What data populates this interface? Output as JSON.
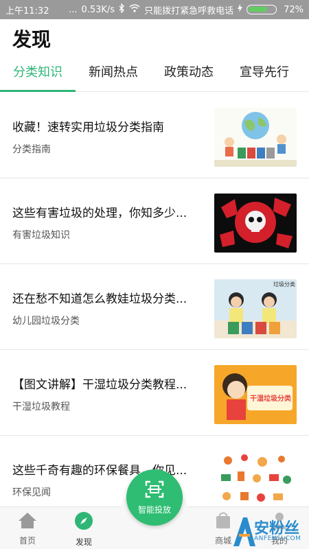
{
  "status_bar": {
    "time": "上午11:32",
    "dots": "...",
    "speed": "0.53K/s",
    "emergency_text": "只能拨打紧急呼救电话",
    "battery_level": 0.72,
    "battery_pct": "72%"
  },
  "header": {
    "title": "发现"
  },
  "tabs": [
    {
      "label": "分类知识",
      "active": true
    },
    {
      "label": "新闻热点",
      "active": false
    },
    {
      "label": "政策动态",
      "active": false
    },
    {
      "label": "宣导先行",
      "active": false
    }
  ],
  "articles": [
    {
      "title": "收藏！速转实用垃圾分类指南",
      "tag": "分类指南",
      "thumb_icon": "recycling-illustration-image"
    },
    {
      "title": "这些有害垃圾的处理，你知多少...",
      "tag": "有害垃圾知识",
      "thumb_icon": "skull-hazard-image"
    },
    {
      "title": "还在愁不知道怎么教娃垃圾分类...",
      "tag": "幼儿园垃圾分类",
      "thumb_icon": "children-sorting-photo",
      "thumb_text": "垃圾分类"
    },
    {
      "title": "【图文讲解】干湿垃圾分类教程...",
      "tag": "干湿垃圾教程",
      "thumb_icon": "dry-wet-sorting-illustration",
      "thumb_text": "干湿垃圾分类"
    },
    {
      "title": "这些千奇有趣的环保餐具，你见...",
      "tag": "环保见闻",
      "thumb_icon": "eco-tableware-illustration"
    }
  ],
  "bottom_nav": {
    "home_label": "首页",
    "discover_label": "发现",
    "fab_label": "智能投放",
    "shop_label": "商城",
    "mine_label": "我的"
  },
  "watermark": {
    "main": "安粉丝",
    "sub": "ANFENSI.COM"
  },
  "colors": {
    "accent": "#2fb676",
    "fab": "#2ebd72"
  }
}
